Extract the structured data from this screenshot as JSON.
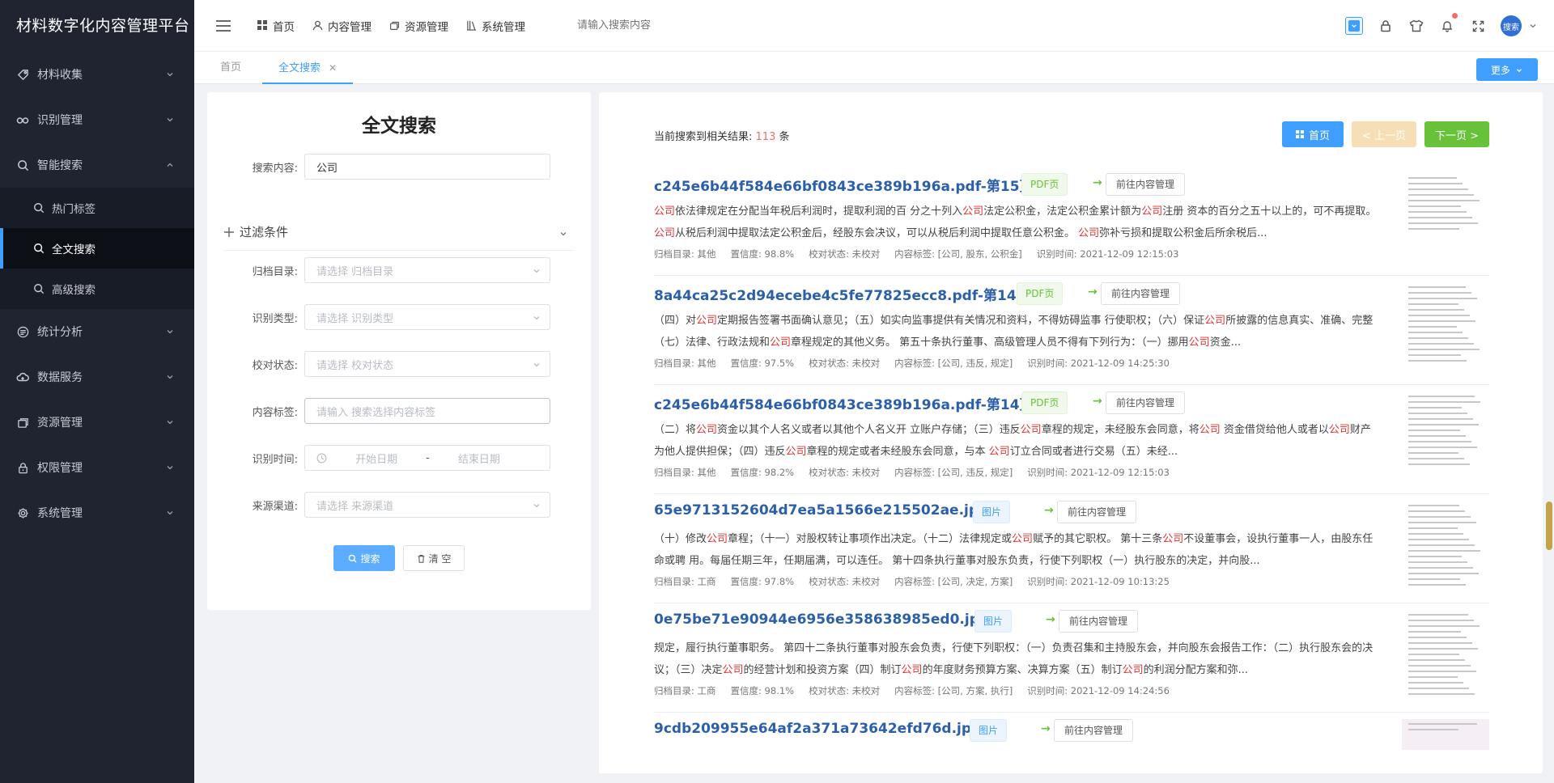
{
  "sidebar": {
    "brand": "材料数字化内容管理平台",
    "items": [
      {
        "label": "材料收集",
        "icon": "tag-icon"
      },
      {
        "label": "识别管理",
        "icon": "glasses-icon"
      },
      {
        "label": "智能搜索",
        "icon": "search-icon",
        "expanded": true,
        "children": [
          {
            "label": "热门标签"
          },
          {
            "label": "全文搜索",
            "active": true
          },
          {
            "label": "高级搜索"
          }
        ]
      },
      {
        "label": "统计分析",
        "icon": "chart-icon"
      },
      {
        "label": "数据服务",
        "icon": "cloud-icon"
      },
      {
        "label": "资源管理",
        "icon": "box-icon"
      },
      {
        "label": "权限管理",
        "icon": "lock-icon"
      },
      {
        "label": "系统管理",
        "icon": "gear-icon"
      }
    ]
  },
  "header": {
    "nav": [
      "首页",
      "内容管理",
      "资源管理",
      "系统管理"
    ],
    "search_placeholder": "请输入搜索内容",
    "avatar_text": "搜索"
  },
  "tabs": {
    "items": [
      "首页",
      "全文搜索"
    ],
    "more_label": "更多"
  },
  "search_form": {
    "title": "全文搜索",
    "content_label": "搜索内容:",
    "content_value": "公司",
    "filter_title": "过滤条件",
    "archive_label": "归档目录:",
    "archive_placeholder": "请选择 归档目录",
    "type_label": "识别类型:",
    "type_placeholder": "请选择 识别类型",
    "proof_label": "校对状态:",
    "proof_placeholder": "请选择 校对状态",
    "tag_label": "内容标签:",
    "tag_placeholder": "请输入 搜索选择内容标签",
    "time_label": "识别时间:",
    "time_start": "开始日期",
    "time_sep": "-",
    "time_end": "结束日期",
    "source_label": "来源渠道:",
    "source_placeholder": "请选择 来源渠道",
    "search_btn": "搜索",
    "clear_btn": "清 空"
  },
  "results": {
    "summary_prefix": "当前搜索到相关结果:",
    "count": "113",
    "summary_suffix": "条",
    "pager": {
      "first": "首页",
      "prev": "< 上一页",
      "next": "下一页 >"
    },
    "goto_label": "前往内容管理",
    "items": [
      {
        "title": "c245e6b44f584e66bf0843ce389b196a.pdf-第15页",
        "tag": "PDF页",
        "snippet_html": "<span class='hl'>公司</span>依法律规定在分配当年税后利润时，提取利润的百 分之十列入<span class='hl'>公司</span>法定公积金，法定公积金累计额为<span class='hl'>公司</span>注册 资本的百分之五十以上的，可不再提取。 <span class='hl'>公司</span>从税后利润中提取法定公积金后，经股东会决议，可以从税后利润中提取任意公积金。 <span class='hl'>公司</span>弥补亏损和提取公积金后所余税后...",
        "meta": [
          "归档目录: 其他",
          "置信度: 98.8%",
          "校对状态: 未校对",
          "内容标签: [公司, 股东, 公积金]",
          "识别时间: 2021-12-09 12:15:03"
        ]
      },
      {
        "title": "8a44ca25c2d94ecebe4c5fe77825ecc8.pdf-第14页",
        "tag": "PDF页",
        "snippet_html": "（四）对<span class='hl'>公司</span>定期报告签署书面确认意见；（五）如实向监事提供有关情况和资料，不得妨碍监事 行使职权；（六）保证<span class='hl'>公司</span>所披露的信息真实、准确、完整（七）法律、行政法规和<span class='hl'>公司</span>章程规定的其他义务。 第五十条执行董事、高级管理人员不得有下列行为：（一）挪用<span class='hl'>公司</span>资金...",
        "meta": [
          "归档目录: 其他",
          "置信度: 97.5%",
          "校对状态: 未校对",
          "内容标签: [公司, 违反, 规定]",
          "识别时间: 2021-12-09 14:25:30"
        ]
      },
      {
        "title": "c245e6b44f584e66bf0843ce389b196a.pdf-第14页",
        "tag": "PDF页",
        "snippet_html": "（二）将<span class='hl'>公司</span>资金以其个人名义或者以其他个人名义开 立账户存储；（三）违反<span class='hl'>公司</span>章程的规定，未经股东会同意，将<span class='hl'>公司</span> 资金借贷给他人或者以<span class='hl'>公司</span>财产为他人提供担保；（四）违反<span class='hl'>公司</span>章程的规定或者未经股东会同意，与本 <span class='hl'>公司</span>订立合同或者进行交易（五）未经...",
        "meta": [
          "归档目录: 其他",
          "置信度: 98.2%",
          "校对状态: 未校对",
          "内容标签: [公司, 违反, 规定]",
          "识别时间: 2021-12-09 12:15:03"
        ]
      },
      {
        "title": "65e9713152604d7ea5a1566e215502ae.jpg",
        "tag": "图片",
        "snippet_html": "（十）修改<span class='hl'>公司</span>章程；（十一）对股权转让事项作出决定。（十二）法律规定或<span class='hl'>公司</span>赋予的其它职权。 第十三条<span class='hl'>公司</span>不设董事会，设执行董事一人，由股东任命或聘 用。每届任期三年，任期届满，可以连任。 第十四条执行董事对股东负责，行使下列职权（一）执行股东的决定，并向股...",
        "meta": [
          "归档目录: 工商",
          "置信度: 97.8%",
          "校对状态: 未校对",
          "内容标签: [公司, 决定, 方案]",
          "识别时间: 2021-12-09 10:13:25"
        ]
      },
      {
        "title": "0e75be71e90944e6956e358638985ed0.jpg",
        "tag": "图片",
        "snippet_html": "规定，履行执行董事职务。 第四十二条执行董事对股东会负责，行使下列职权：（一）负责召集和主持股东会，并向股东会报告工作：（二）执行股东会的决议；（三）决定<span class='hl'>公司</span>的经营计划和投资方案（四）制订<span class='hl'>公司</span>的年度财务预算方案、决算方案（五）制订<span class='hl'>公司</span>的利润分配方案和弥...",
        "meta": [
          "归档目录: 工商",
          "置信度: 98.1%",
          "校对状态: 未校对",
          "内容标签: [公司, 方案, 执行]",
          "识别时间: 2021-12-09 14:24:56"
        ]
      },
      {
        "title": "9cdb209955e64af2a371a73642efd76d.jpg",
        "tag": "图片",
        "snippet_html": "",
        "meta": []
      }
    ]
  },
  "colors": {
    "primary": "#409eff",
    "success": "#67c23a",
    "warning_light": "#f7dfb5",
    "highlight": "#e83030",
    "sidebar_bg": "#1f2430",
    "title_link": "#2b5fa8"
  }
}
